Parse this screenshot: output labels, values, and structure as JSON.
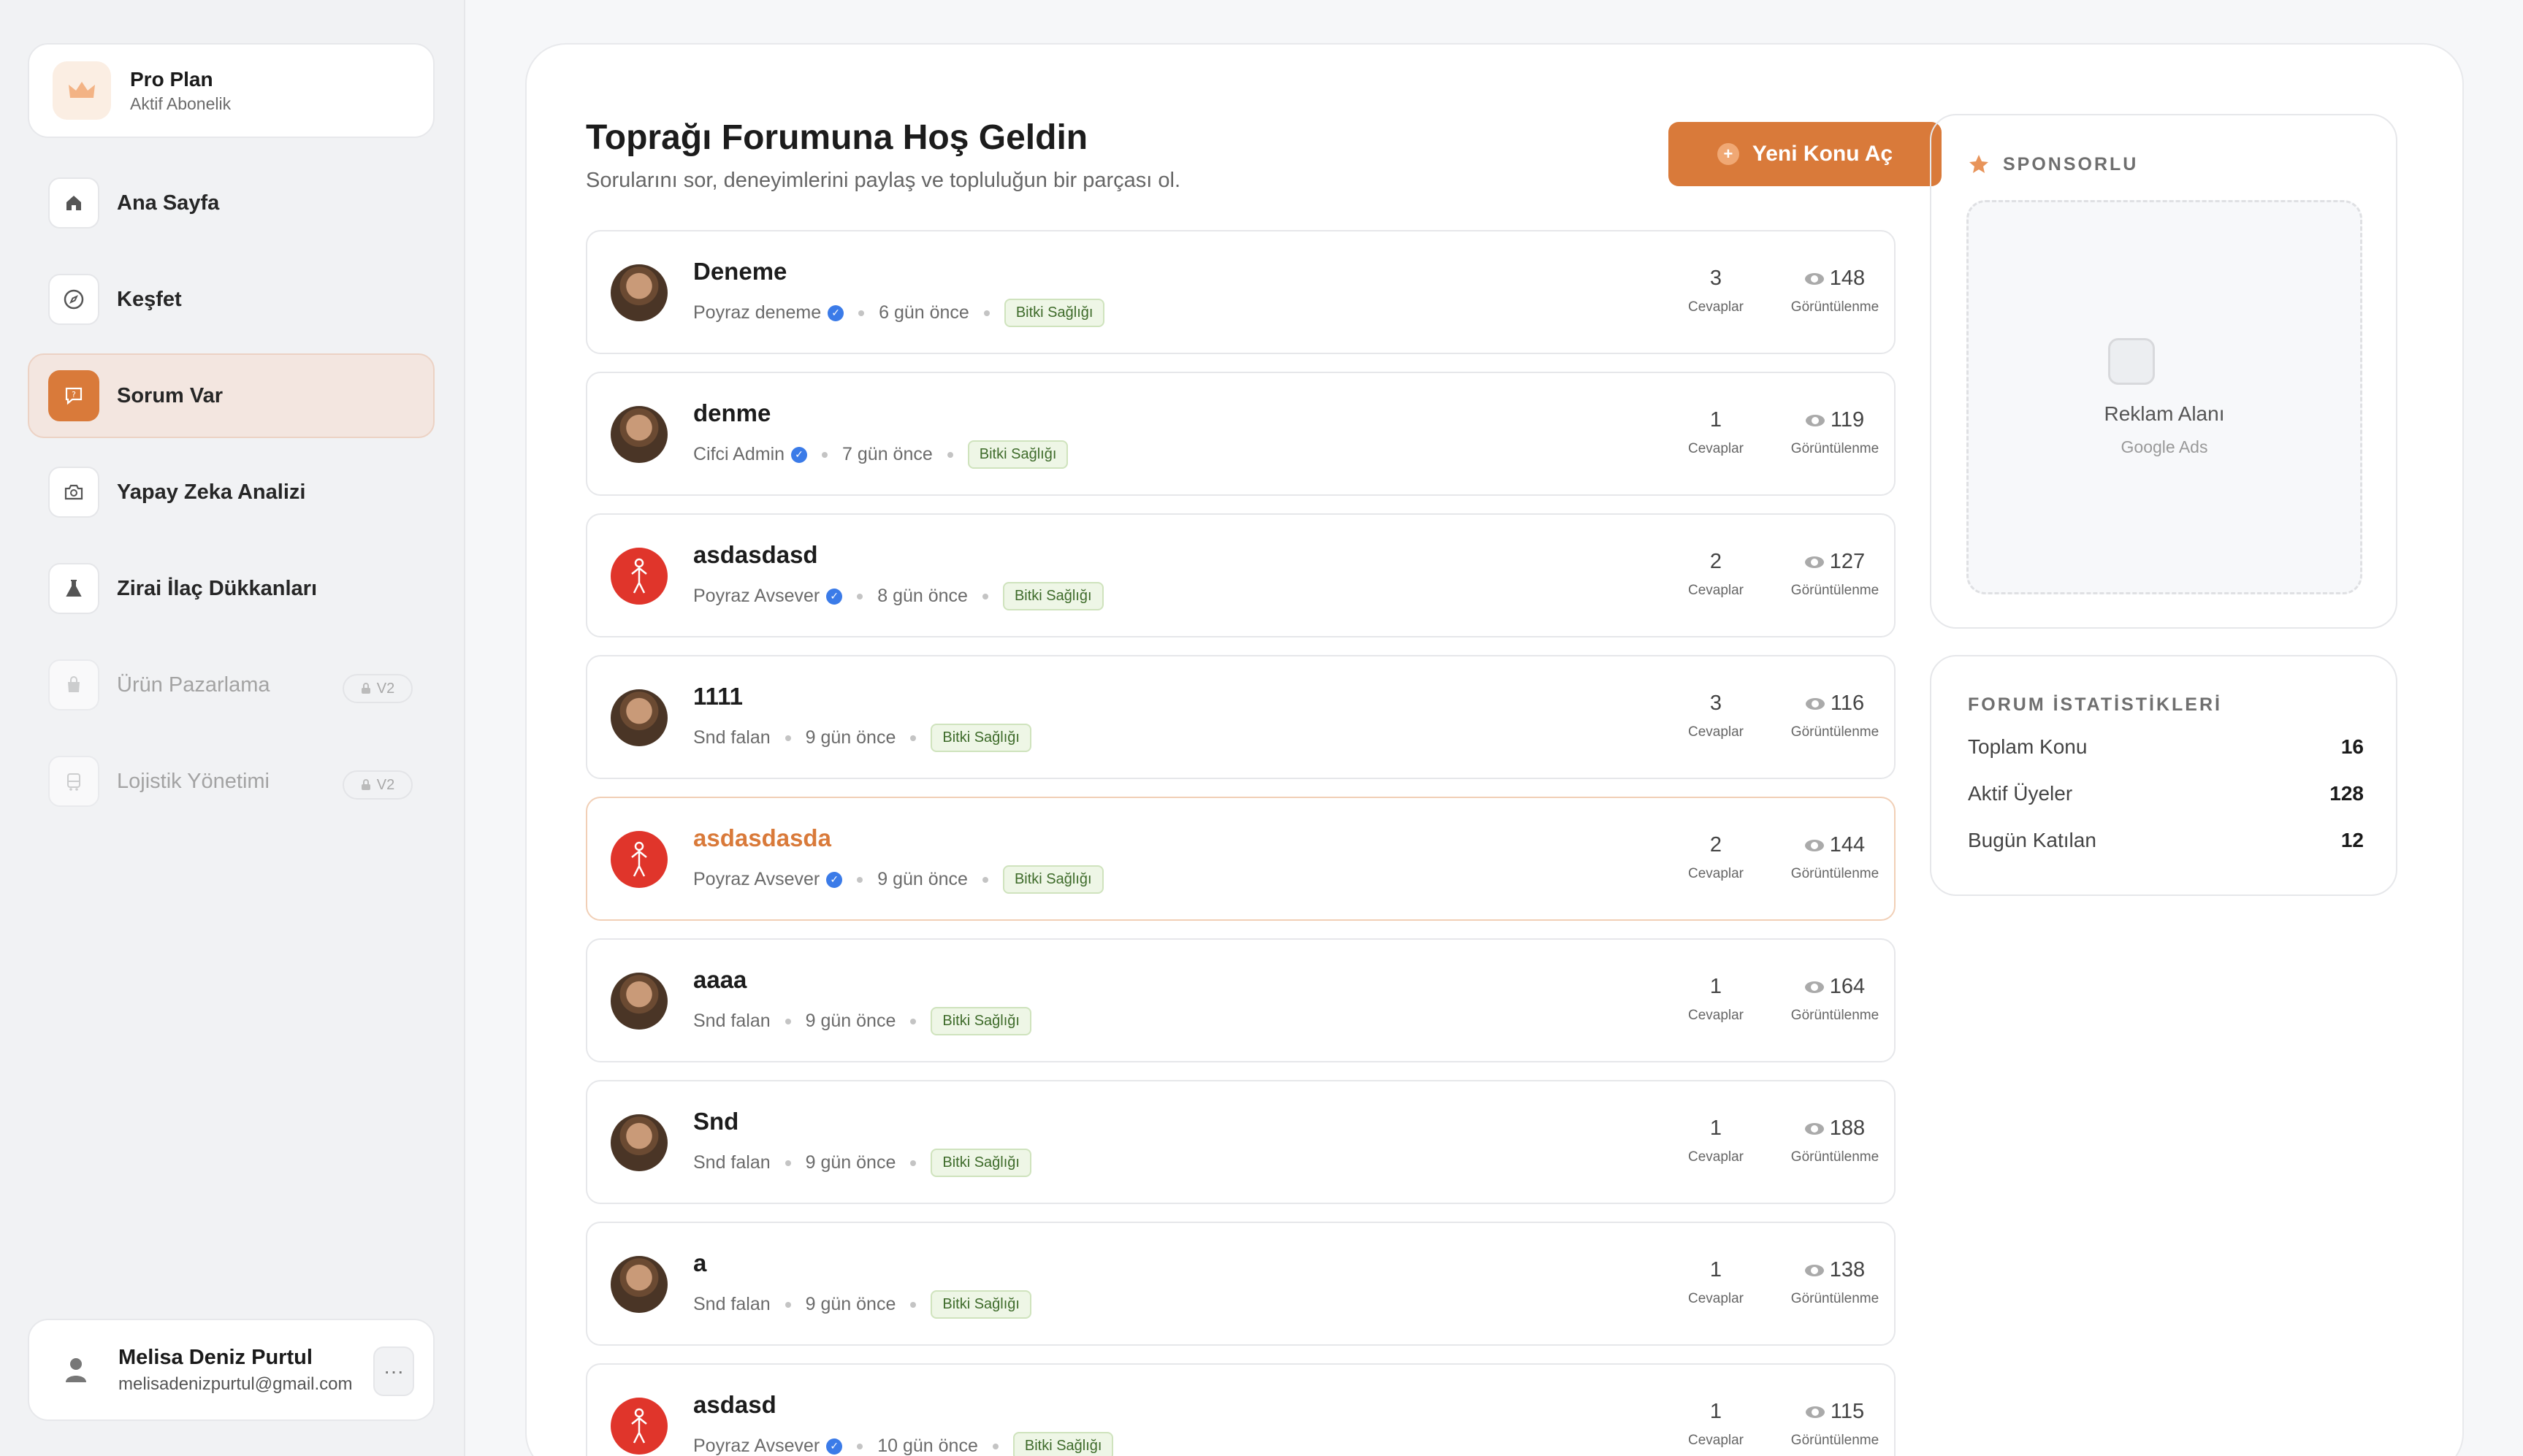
{
  "colors": {
    "accent": "#d97a3a",
    "verified": "#3b7be8",
    "tag_bg": "#eef6e6",
    "tag_text": "#3e6b2a"
  },
  "plan": {
    "title": "Pro Plan",
    "subtitle": "Aktif Abonelik",
    "icon": "crown-icon"
  },
  "sidebar": {
    "items": [
      {
        "label": "Ana Sayfa",
        "icon": "home-icon"
      },
      {
        "label": "Keşfet",
        "icon": "compass-icon"
      },
      {
        "label": "Sorum Var",
        "icon": "question-chat-icon",
        "active": true
      },
      {
        "label": "Yapay Zeka Analizi",
        "icon": "camera-scan-icon"
      },
      {
        "label": "Zirai İlaç Dükkanları",
        "icon": "flask-icon"
      },
      {
        "label": "Ürün Pazarlama",
        "icon": "bag-icon",
        "disabled": true,
        "badge": "V2"
      },
      {
        "label": "Lojistik Yönetimi",
        "icon": "bus-icon",
        "disabled": true,
        "badge": "V2"
      }
    ]
  },
  "user": {
    "name": "Melisa Deniz Purtul",
    "email": "melisadenizpurtul@gmail.com",
    "more_label": "···"
  },
  "header": {
    "title": "Toprağı Forumuna Hoş Geldin",
    "subtitle": "Sorularını sor, deneyimlerini paylaş ve topluluğun bir parçası ol.",
    "new_topic_label": "Yeni Konu Aç"
  },
  "labels": {
    "replies": "Cevaplar",
    "views": "Görüntülenme"
  },
  "topics": [
    {
      "title": "Deneme",
      "author": "Poyraz deneme",
      "verified": true,
      "time": "6 gün önce",
      "tag": "Bitki Sağlığı",
      "replies": "3",
      "views": "148",
      "avatar": "photo"
    },
    {
      "title": "denme",
      "author": "Cifci Admin",
      "verified": true,
      "time": "7 gün önce",
      "tag": "Bitki Sağlığı",
      "replies": "1",
      "views": "119",
      "avatar": "photo"
    },
    {
      "title": "asdasdasd",
      "author": "Poyraz Avsever",
      "verified": true,
      "time": "8 gün önce",
      "tag": "Bitki Sağlığı",
      "replies": "2",
      "views": "127",
      "avatar": "red"
    },
    {
      "title": "1111",
      "author": "Snd falan",
      "verified": false,
      "time": "9 gün önce",
      "tag": "Bitki Sağlığı",
      "replies": "3",
      "views": "116",
      "avatar": "photo"
    },
    {
      "title": "asdasdasda",
      "author": "Poyraz Avsever",
      "verified": true,
      "time": "9 gün önce",
      "tag": "Bitki Sağlığı",
      "replies": "2",
      "views": "144",
      "avatar": "red",
      "highlighted": true
    },
    {
      "title": "aaaa",
      "author": "Snd falan",
      "verified": false,
      "time": "9 gün önce",
      "tag": "Bitki Sağlığı",
      "replies": "1",
      "views": "164",
      "avatar": "photo"
    },
    {
      "title": "Snd",
      "author": "Snd falan",
      "verified": false,
      "time": "9 gün önce",
      "tag": "Bitki Sağlığı",
      "replies": "1",
      "views": "188",
      "avatar": "photo"
    },
    {
      "title": "a",
      "author": "Snd falan",
      "verified": false,
      "time": "9 gün önce",
      "tag": "Bitki Sağlığı",
      "replies": "1",
      "views": "138",
      "avatar": "photo"
    },
    {
      "title": "asdasd",
      "author": "Poyraz Avsever",
      "verified": true,
      "time": "10 gün önce",
      "tag": "Bitki Sağlığı",
      "replies": "1",
      "views": "115",
      "avatar": "red"
    }
  ],
  "sponsor": {
    "heading": "SPONSORLU",
    "ad_title": "Reklam Alanı",
    "ad_sub": "Google Ads"
  },
  "forum_stats": {
    "heading": "FORUM İSTATİSTİKLERİ",
    "rows": [
      {
        "label": "Toplam Konu",
        "value": "16"
      },
      {
        "label": "Aktif Üyeler",
        "value": "128"
      },
      {
        "label": "Bugün Katılan",
        "value": "12"
      }
    ]
  }
}
